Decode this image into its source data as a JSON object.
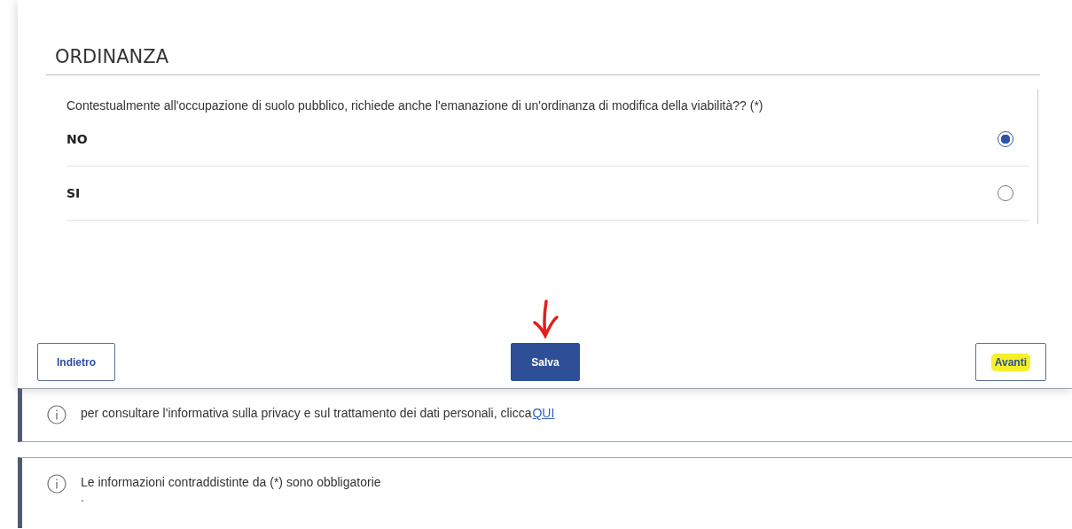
{
  "section": {
    "title": "ORDINANZA"
  },
  "question": {
    "label": "Contestualmente all'occupazione di suolo pubblico, richiede anche l'emanazione di un'ordinanza di modifica della viabilità?? (*)",
    "options": [
      {
        "label": "NO",
        "selected": true
      },
      {
        "label": "SI",
        "selected": false
      }
    ]
  },
  "buttons": [
    {
      "label": "Indietro",
      "kind": "outline",
      "highlighted": false
    },
    {
      "label": "Salva",
      "kind": "primary",
      "highlighted": false,
      "annotated": true
    },
    {
      "label": "Avanti",
      "kind": "outline",
      "highlighted": true
    }
  ],
  "notices": [
    {
      "text": "per consultare l'informativa sulla privacy e sul trattamento dei dati personali, clicca",
      "link": "QUI"
    },
    {
      "text": "Le informazioni contraddistinte da (*) sono obbligatorie",
      "note": "."
    }
  ]
}
